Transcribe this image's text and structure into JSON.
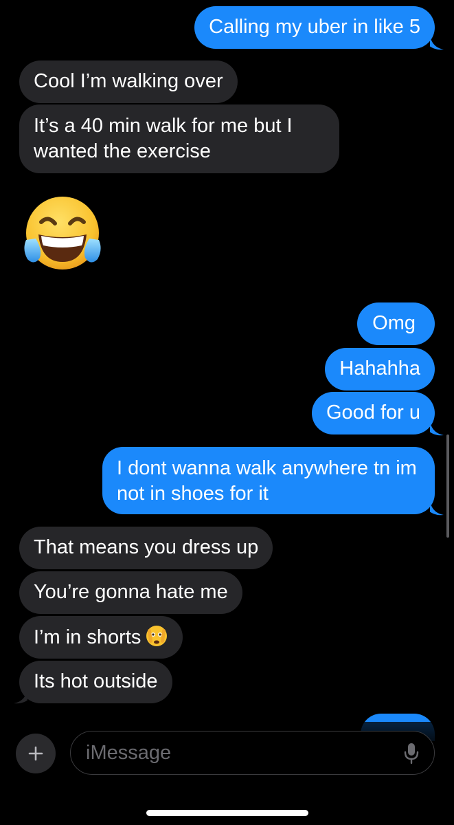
{
  "messages": [
    {
      "text": "Calling my uber in like 5",
      "direction": "outgoing"
    },
    {
      "text": "Cool I’m walking over",
      "direction": "incoming"
    },
    {
      "text": "It’s a 40 min walk for me but I wanted the exercise",
      "direction": "incoming"
    },
    {
      "text": "😂",
      "direction": "incoming",
      "type": "emoji"
    },
    {
      "text": "Omg",
      "direction": "outgoing"
    },
    {
      "text": "Hahahha",
      "direction": "outgoing"
    },
    {
      "text": "Good for u",
      "direction": "outgoing"
    },
    {
      "text": "I dont wanna walk anywhere tn im not in shoes for it",
      "direction": "outgoing"
    },
    {
      "text": "That means you dress up",
      "direction": "incoming"
    },
    {
      "text": "You’re gonna hate me",
      "direction": "incoming"
    },
    {
      "text": "I’m in shorts",
      "direction": "incoming",
      "emoji": "🫣"
    },
    {
      "text": "Its hot outside",
      "direction": "incoming"
    }
  ],
  "composer": {
    "placeholder": "iMessage",
    "add_icon": "plus-icon",
    "mic_icon": "microphone-icon"
  },
  "colors": {
    "outgoing_bubble": "#1b89fb",
    "incoming_bubble": "#262629",
    "background": "#000000",
    "text": "#ffffff"
  }
}
